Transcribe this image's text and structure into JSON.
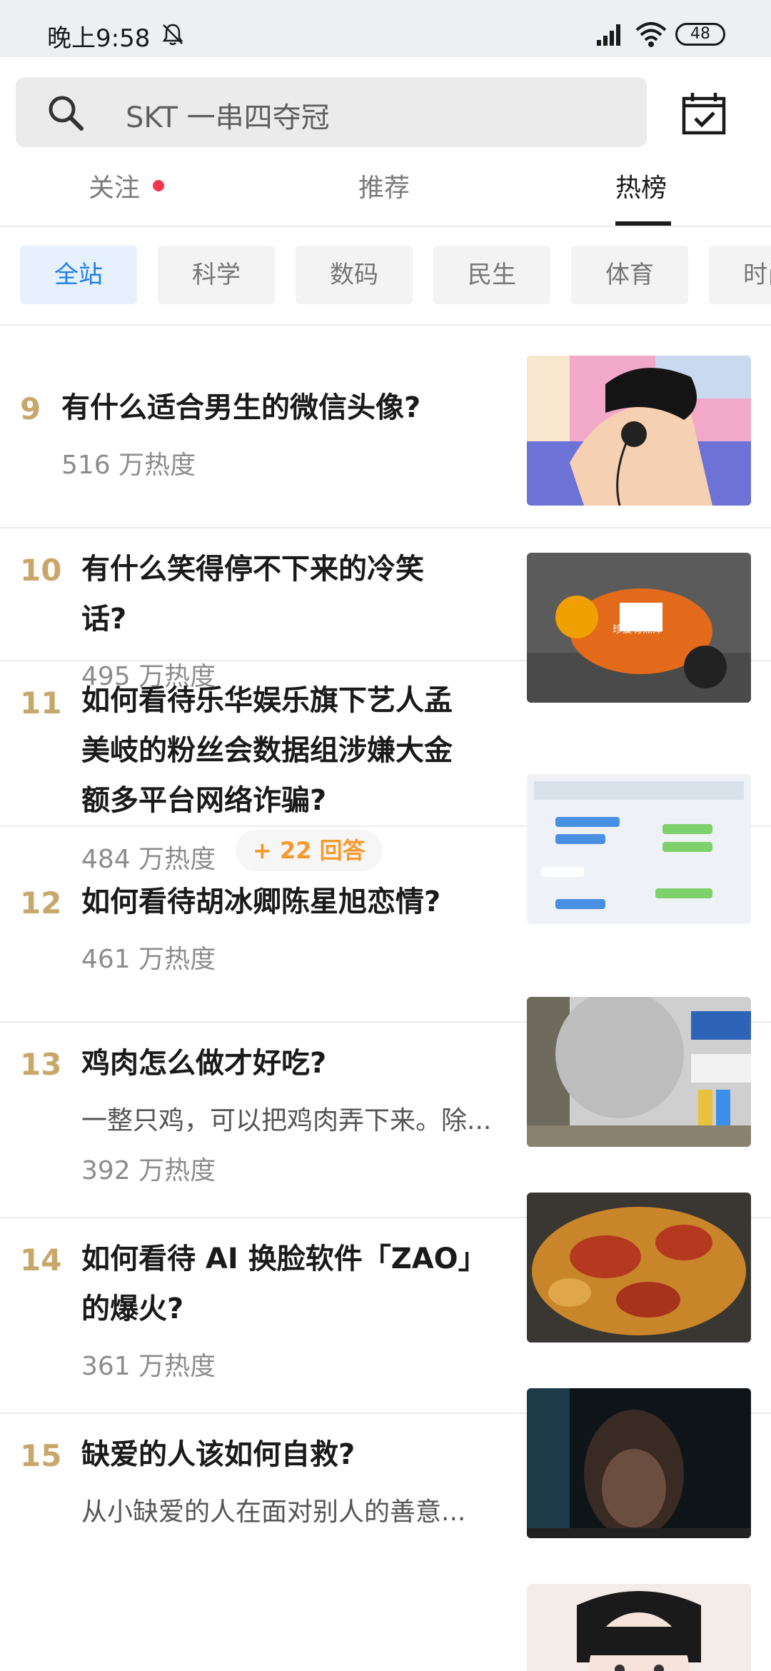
{
  "status_bar": {
    "time": "晚上9:58",
    "battery": "48"
  },
  "search": {
    "placeholder": "SKT 一串四夺冠"
  },
  "tabs": [
    {
      "label": "关注"
    },
    {
      "label": "推荐"
    },
    {
      "label": "热榜"
    }
  ],
  "categories": [
    "全站",
    "科学",
    "数码",
    "民生",
    "体育",
    "时尚"
  ],
  "items": [
    {
      "rank": "9",
      "title_lines": [
        "有什么适合男生的微信头像?"
      ],
      "heat": "516 万热度"
    },
    {
      "rank": "10",
      "title_lines": [
        "有什么笑得停不下来的冷笑",
        "话?"
      ],
      "heat": "495 万热度",
      "thumb_caption": "珍爱有点痒"
    },
    {
      "rank": "11",
      "title_lines": [
        "如何看待乐华娱乐旗下艺人孟",
        "美岐的粉丝会数据组涉嫌大金",
        "额多平台网络诈骗?"
      ],
      "heat": "484 万热度",
      "badge": "+ 22 回答"
    },
    {
      "rank": "12",
      "title_lines": [
        "如何看待胡冰卿陈星旭恋情?"
      ],
      "heat": "461 万热度"
    },
    {
      "rank": "13",
      "title_lines": [
        "鸡肉怎么做才好吃?"
      ],
      "snippet": "一整只鸡，可以把鸡肉弄下来。除...",
      "heat": "392 万热度"
    },
    {
      "rank": "14",
      "title_lines": [
        "如何看待 AI 换脸软件「ZAO」",
        "的爆火?"
      ],
      "heat": "361 万热度"
    },
    {
      "rank": "15",
      "title_lines": [
        "缺爱的人该如何自救?"
      ],
      "snippet": "从小缺爱的人在面对别人的善意..."
    }
  ],
  "colors": {
    "accent": "#1f7fe8",
    "rank": "#c8a86a",
    "badge": "#f7992c",
    "dot": "#f5344d"
  }
}
